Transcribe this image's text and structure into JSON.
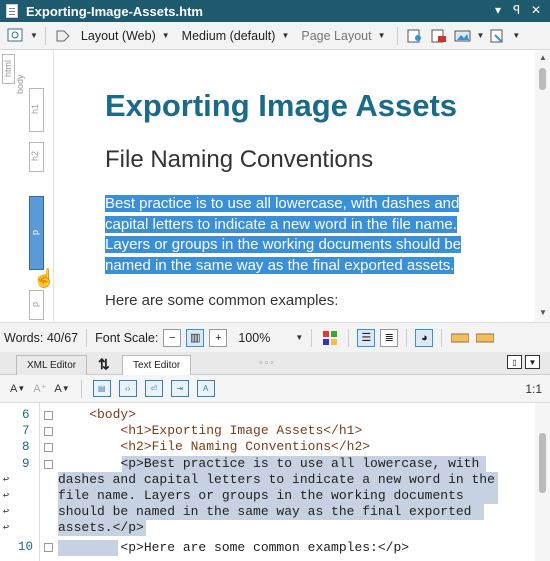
{
  "window": {
    "title": "Exporting-Image-Assets.htm",
    "controls": [
      "▾",
      "ꟼ",
      "✕"
    ]
  },
  "toolbar": {
    "layout": "Layout (Web)",
    "medium": "Medium (default)",
    "page_layout": "Page Layout"
  },
  "ruler": {
    "tags": [
      "html",
      "body",
      "h1",
      "h2",
      "p",
      "p"
    ]
  },
  "document": {
    "h1": "Exporting Image Assets",
    "h2": "File Naming Conventions",
    "para1_lines": [
      "Best practice is to use all lowercase, with dashes and",
      "capital letters to indicate a new word in the file name.",
      "Layers or groups in the working documents should be",
      "named in the same way as the final exported assets."
    ],
    "para2": "Here are some common examples:"
  },
  "status": {
    "words": "Words: 40/67",
    "font_scale": "Font Scale:",
    "zoom": "100%"
  },
  "tabs": {
    "xml": "XML Editor",
    "text": "Text Editor"
  },
  "format": {
    "position": "1:1"
  },
  "code": {
    "lines": [
      {
        "n": "6",
        "text": "    <body>"
      },
      {
        "n": "7",
        "text": "        <h1>Exporting Image Assets</h1>"
      },
      {
        "n": "8",
        "text": "        <h2>File Naming Conventions</h2>"
      },
      {
        "n": "9",
        "text": "        <p>Best practice is to use all lowercase, with"
      },
      {
        "n": "",
        "text": "dashes and capital letters to indicate a new word in the"
      },
      {
        "n": "",
        "text": "file name. Layers or groups in the working documents"
      },
      {
        "n": "",
        "text": "should be named in the same way as the final exported"
      },
      {
        "n": "",
        "text": "assets.</p>"
      },
      {
        "n": "10",
        "text": "        <p>Here are some common examples:</p>"
      }
    ]
  }
}
